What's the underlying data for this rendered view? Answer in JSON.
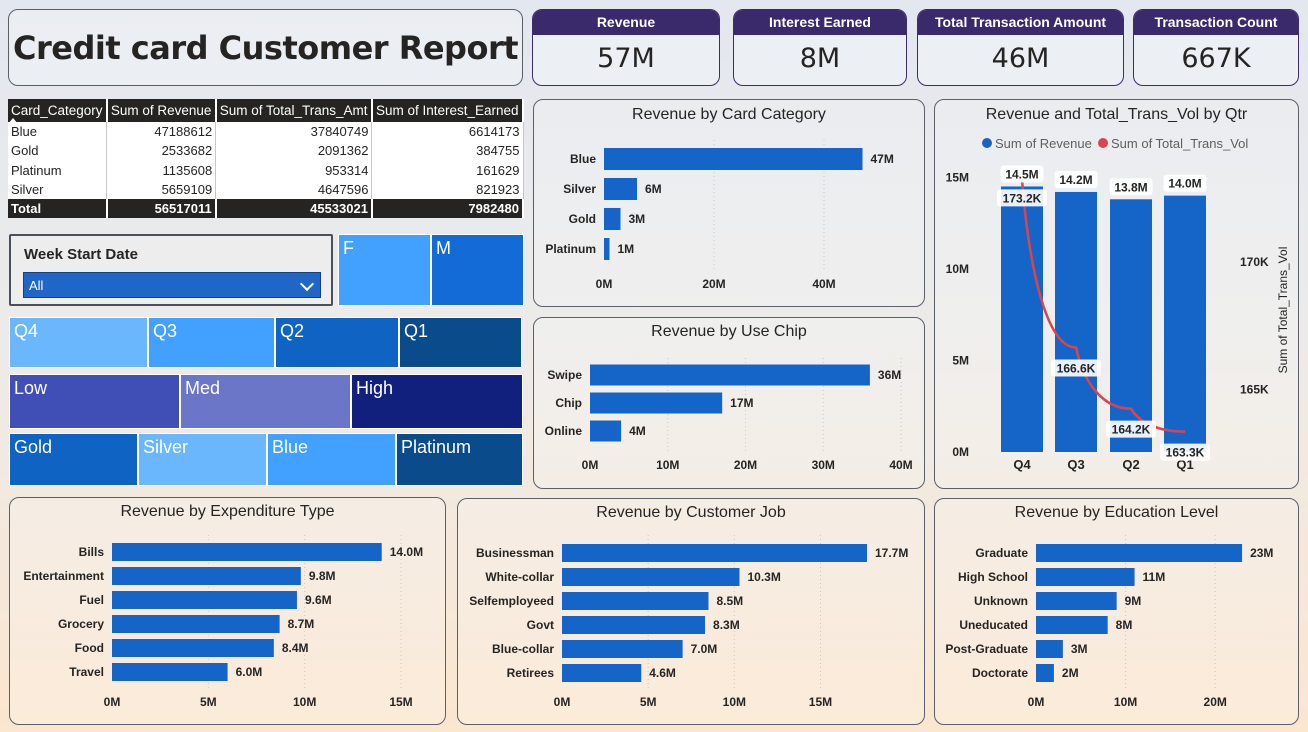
{
  "report_title": "Credit card Customer Report",
  "kpis": [
    {
      "label": "Revenue",
      "value": "57M"
    },
    {
      "label": "Interest Earned",
      "value": "8M"
    },
    {
      "label": "Total Transaction Amount",
      "value": "46M"
    },
    {
      "label": "Transaction Count",
      "value": "667K"
    }
  ],
  "matrix": {
    "headers": [
      "Card_Category",
      "Sum of Revenue",
      "Sum of Total_Trans_Amt",
      "Sum of Interest_Earned"
    ],
    "rows": [
      [
        "Blue",
        "47188612",
        "37840749",
        "6614173"
      ],
      [
        "Gold",
        "2533682",
        "2091362",
        "384755"
      ],
      [
        "Platinum",
        "1135608",
        "953314",
        "161629"
      ],
      [
        "Silver",
        "5659109",
        "4647596",
        "821923"
      ]
    ],
    "total": [
      "Total",
      "56517011",
      "45533021",
      "7982480"
    ]
  },
  "slicer": {
    "label": "Week Start Date",
    "value": "All"
  },
  "tiles": {
    "gender": [
      {
        "label": "F",
        "color": "#42a1ff"
      },
      {
        "label": "M",
        "color": "#126bd6"
      }
    ],
    "quarter": [
      {
        "label": "Q4",
        "color": "#6ab7fe"
      },
      {
        "label": "Q3",
        "color": "#42a1ff"
      },
      {
        "label": "Q2",
        "color": "#0f63c2"
      },
      {
        "label": "Q1",
        "color": "#0a4b8b"
      }
    ],
    "income": [
      {
        "label": "Low",
        "color": "#3f4fb6"
      },
      {
        "label": "Med",
        "color": "#6c76c8"
      },
      {
        "label": "High",
        "color": "#10207c"
      }
    ],
    "card": [
      {
        "label": "Gold",
        "color": "#0f63c2"
      },
      {
        "label": "Silver",
        "color": "#6ab7fe"
      },
      {
        "label": "Blue",
        "color": "#42a1ff"
      },
      {
        "label": "Platinum",
        "color": "#0a4b8b"
      }
    ]
  },
  "colors": {
    "bar": "#1565c8",
    "line": "#d9454f",
    "kpi_header": "#3b2a6b"
  },
  "chart_data": [
    {
      "id": "card_category",
      "type": "bar",
      "title": "Revenue by Card Category",
      "categories": [
        "Blue",
        "Silver",
        "Gold",
        "Platinum"
      ],
      "values": [
        47,
        6,
        3,
        1
      ],
      "labels": [
        "47M",
        "6M",
        "3M",
        "1M"
      ],
      "xlim": [
        0,
        50
      ],
      "ticks": [
        "0M",
        "20M",
        "40M"
      ],
      "tick_values": [
        0,
        20,
        40
      ]
    },
    {
      "id": "use_chip",
      "type": "bar",
      "title": "Revenue by Use Chip",
      "categories": [
        "Swipe",
        "Chip",
        "Online"
      ],
      "values": [
        36,
        17,
        4
      ],
      "labels": [
        "36M",
        "17M",
        "4M"
      ],
      "xlim": [
        0,
        40
      ],
      "ticks": [
        "0M",
        "10M",
        "20M",
        "30M",
        "40M"
      ],
      "tick_values": [
        0,
        10,
        20,
        30,
        40
      ]
    },
    {
      "id": "quarter",
      "type": "bar+line",
      "title": "Revenue and Total_Trans_Vol by Qtr",
      "categories": [
        "Q4",
        "Q3",
        "Q2",
        "Q1"
      ],
      "series": [
        {
          "name": "Sum of Revenue",
          "values": [
            14.5,
            14.2,
            13.8,
            14.0
          ],
          "labels": [
            "14.5M",
            "14.2M",
            "13.8M",
            "14.0M"
          ]
        },
        {
          "name": "Sum of Total_Trans_Vol",
          "values": [
            173.2,
            166.6,
            164.2,
            163.3
          ],
          "labels": [
            "173.2K",
            "166.6K",
            "164.2K",
            "163.3K"
          ]
        }
      ],
      "ylim": [
        0,
        16
      ],
      "y_ticks": [
        "0M",
        "5M",
        "10M",
        "15M"
      ],
      "y_tick_values": [
        0,
        5,
        10,
        15
      ],
      "y2_ticks": [
        "165K",
        "170K"
      ],
      "y2_tick_values": [
        165,
        170
      ],
      "y2lim": [
        162.5,
        174
      ],
      "y2label": "Sum of Total_Trans_Vol",
      "legend": "top"
    },
    {
      "id": "expenditure",
      "type": "bar",
      "title": "Revenue by Expenditure Type",
      "categories": [
        "Bills",
        "Entertainment",
        "Fuel",
        "Grocery",
        "Food",
        "Travel"
      ],
      "values": [
        14.0,
        9.8,
        9.6,
        8.7,
        8.4,
        6.0
      ],
      "labels": [
        "14.0M",
        "9.8M",
        "9.6M",
        "8.7M",
        "8.4M",
        "6.0M"
      ],
      "xlim": [
        0,
        15
      ],
      "ticks": [
        "0M",
        "5M",
        "10M",
        "15M"
      ],
      "tick_values": [
        0,
        5,
        10,
        15
      ]
    },
    {
      "id": "job",
      "type": "bar",
      "title": "Revenue by Customer Job",
      "categories": [
        "Businessman",
        "White-collar",
        "Selfemployeed",
        "Govt",
        "Blue-collar",
        "Retirees"
      ],
      "values": [
        17.7,
        10.3,
        8.5,
        8.3,
        7.0,
        4.6
      ],
      "labels": [
        "17.7M",
        "10.3M",
        "8.5M",
        "8.3M",
        "7.0M",
        "4.6M"
      ],
      "xlim": [
        0,
        17.7
      ],
      "ticks": [
        "0M",
        "5M",
        "10M",
        "15M"
      ],
      "tick_values": [
        0,
        5,
        10,
        15
      ]
    },
    {
      "id": "education",
      "type": "bar",
      "title": "Revenue by Education Level",
      "categories": [
        "Graduate",
        "High School",
        "Unknown",
        "Uneducated",
        "Post-Graduate",
        "Doctorate"
      ],
      "values": [
        23,
        11,
        9,
        8,
        3,
        2
      ],
      "labels": [
        "23M",
        "11M",
        "9M",
        "8M",
        "3M",
        "2M"
      ],
      "xlim": [
        0,
        25
      ],
      "ticks": [
        "0M",
        "10M",
        "20M"
      ],
      "tick_values": [
        0,
        10,
        20
      ]
    }
  ]
}
